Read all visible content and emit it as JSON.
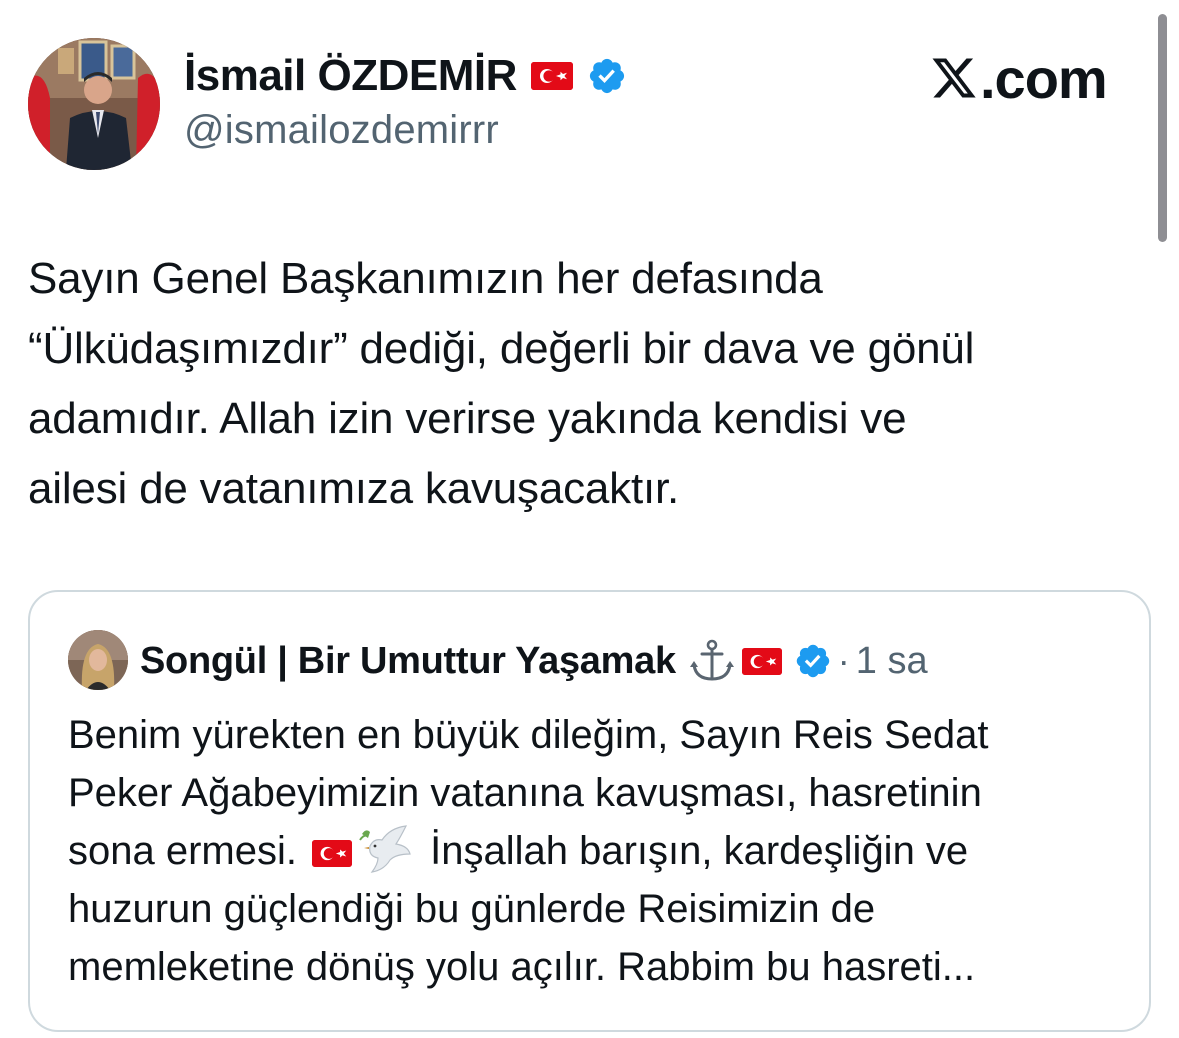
{
  "post": {
    "author": {
      "name": "İsmail ÖZDEMİR",
      "handle": "@ismailozdemirrr",
      "flag_icon": "turkey-flag-icon",
      "verified_icon": "verified-badge-icon"
    },
    "brand": {
      "logo_icon": "x-logo-icon",
      "text": ".com"
    },
    "text_lines": [
      "Sayın Genel Başkanımızın her defasında",
      "“Ülküdaşımızdır” dediği, değerli bir dava ve gönül",
      "adamıdır. Allah izin verirse yakında kendisi ve",
      "ailesi de vatanımıza kavuşacaktır."
    ]
  },
  "quote": {
    "author": {
      "name": "Songül | Bir Umuttur Yaşamak",
      "anchor_icon": "anchor-icon",
      "flag_icon": "turkey-flag-icon",
      "verified_icon": "verified-badge-icon"
    },
    "separator": "·",
    "time": "1 sa",
    "text": {
      "line1": "Benim yürekten en büyük dileğim, Sayın Reis Sedat",
      "line2": "Peker Ağabeyimizin vatanına kavuşması, hasretinin",
      "line3_before": "sona ermesi.",
      "line3_after": "İnşallah barışın, kardeşliğin ve",
      "line4": "huzurun güçlendiği bu günlerde Reisimizin de",
      "line5": "memleketine dönüş yolu açılır. Rabbim bu hasreti..."
    }
  },
  "colors": {
    "text_primary": "#0f1419",
    "text_secondary": "#536471",
    "verified_blue": "#1d9bf0",
    "flag_red": "#e30a17",
    "card_border": "#cfd9de"
  }
}
